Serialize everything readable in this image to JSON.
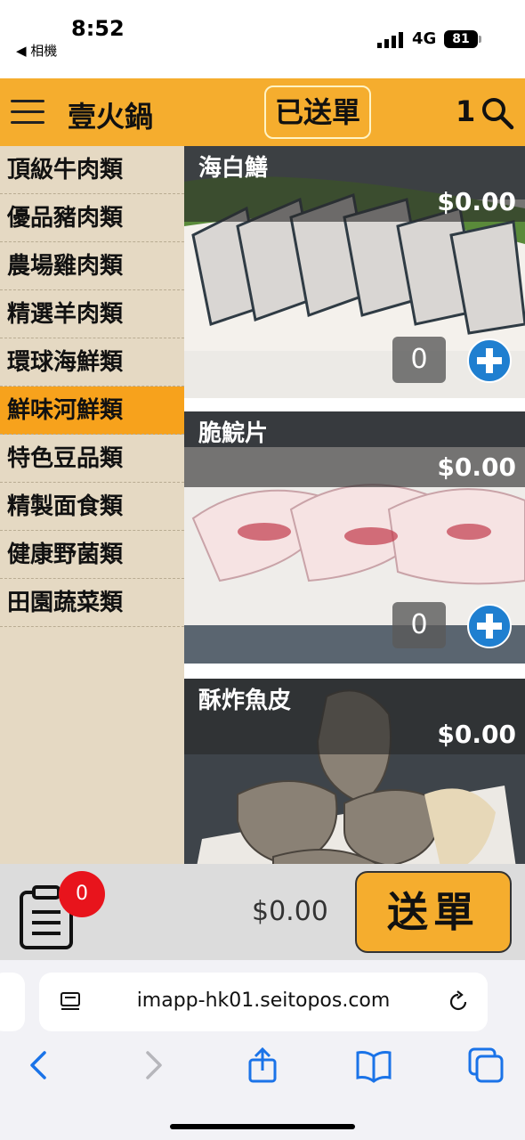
{
  "status": {
    "time": "8:52",
    "back_app": "◀ 相機",
    "network": "4G",
    "battery": "81"
  },
  "header": {
    "title": "壹火鍋",
    "sent_button": "已送單",
    "table_no": "1"
  },
  "sidebar": {
    "items": [
      {
        "label": "頂級牛肉類"
      },
      {
        "label": "優品豬肉類"
      },
      {
        "label": "農場雞肉類"
      },
      {
        "label": "精選羊肉類"
      },
      {
        "label": "環球海鮮類"
      },
      {
        "label": "鮮味河鮮類"
      },
      {
        "label": "特色豆品類"
      },
      {
        "label": "精製面食類"
      },
      {
        "label": "健康野菌類"
      },
      {
        "label": "田園蔬菜類"
      }
    ]
  },
  "products": [
    {
      "name": "海白鱔",
      "price": "$0.00",
      "qty": "0"
    },
    {
      "name": "脆鯇片",
      "price": "$0.00",
      "qty": "0"
    },
    {
      "name": "酥炸魚皮",
      "price": "$0.00"
    }
  ],
  "order": {
    "count": "0",
    "total": "$0.00",
    "submit": "送單"
  },
  "browser": {
    "url": "imapp-hk01.seitopos.com"
  },
  "colors": {
    "accent": "#f5ad2e",
    "active_category": "#f7a21c",
    "badge": "#e8141c",
    "safari_blue": "#1a73e8"
  }
}
